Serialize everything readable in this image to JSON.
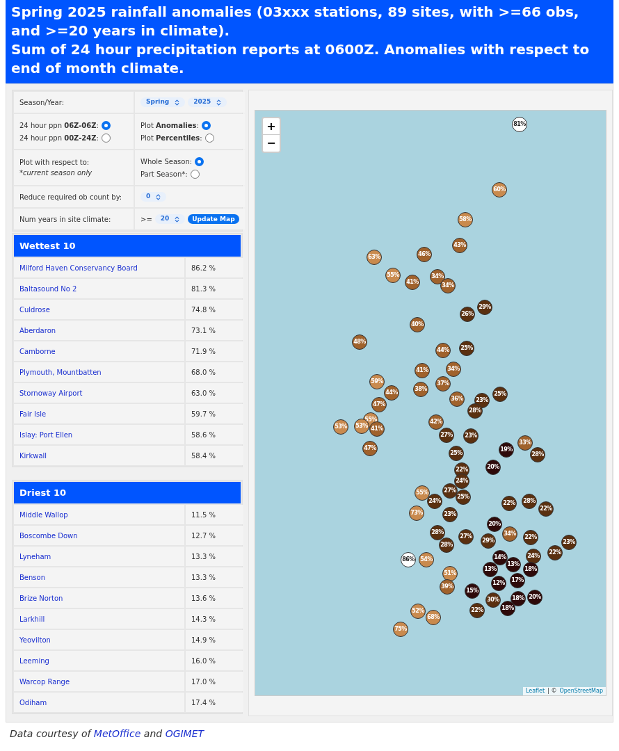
{
  "header": {
    "lines": [
      "Spring 2025 rainfall anomalies (03xxx stations, 89 sites, with >=66 obs, and >=20 years in climate).",
      "Sum of 24 hour precipitation reports at 0600Z. Anomalies with respect to end of month climate."
    ]
  },
  "controls": {
    "season_label": "Season/Year:",
    "season_select": "Spring",
    "year_select": "2025",
    "ppn_options": [
      {
        "label": "24 hour ppn **06Z-06Z**:",
        "selected": true
      },
      {
        "label": "24 hour ppn **00Z-24Z**:",
        "selected": false
      }
    ],
    "plot_options": [
      {
        "label": "Plot **Anomalies**:",
        "selected": true
      },
      {
        "label": "Plot **Percentiles**:",
        "selected": false
      }
    ],
    "respect_label": "Plot with respect to:",
    "respect_note": "*current season only",
    "respect_options": [
      {
        "label": "Whole Season:",
        "selected": true
      },
      {
        "label": "Part Season*:",
        "selected": false
      }
    ],
    "reduce_label": "Reduce required ob count by:",
    "reduce_select": "0",
    "years_label": "Num years in site climate:",
    "years_prefix": ">=",
    "years_select": "20",
    "update_button": "Update Map"
  },
  "tables": [
    {
      "title": "Wettest 10",
      "rows": [
        {
          "station": "Milford Haven Conservancy Board",
          "value": "86.2 %"
        },
        {
          "station": "Baltasound No 2",
          "value": "81.3 %"
        },
        {
          "station": "Culdrose",
          "value": "74.8 %"
        },
        {
          "station": "Aberdaron",
          "value": "73.1 %"
        },
        {
          "station": "Camborne",
          "value": "71.9 %"
        },
        {
          "station": "Plymouth, Mountbatten",
          "value": "68.0 %"
        },
        {
          "station": "Stornoway Airport",
          "value": "63.0 %"
        },
        {
          "station": "Fair Isle",
          "value": "59.7 %"
        },
        {
          "station": "Islay: Port Ellen",
          "value": "58.6 %"
        },
        {
          "station": "Kirkwall",
          "value": "58.4 %"
        }
      ]
    },
    {
      "title": "Driest 10",
      "rows": [
        {
          "station": "Middle Wallop",
          "value": "11.5 %"
        },
        {
          "station": "Boscombe Down",
          "value": "12.7 %"
        },
        {
          "station": "Lyneham",
          "value": "13.3 %"
        },
        {
          "station": "Benson",
          "value": "13.3 %"
        },
        {
          "station": "Brize Norton",
          "value": "13.6 %"
        },
        {
          "station": "Larkhill",
          "value": "14.3 %"
        },
        {
          "station": "Yeovilton",
          "value": "14.9 %"
        },
        {
          "station": "Leeming",
          "value": "16.0 %"
        },
        {
          "station": "Warcop Range",
          "value": "17.0 %"
        },
        {
          "station": "Odiham",
          "value": "17.4 %"
        }
      ]
    }
  ],
  "map": {
    "zoom_in": "+",
    "zoom_out": "−",
    "markers": [
      {
        "label": "81%",
        "color": "#ffffff"
      },
      {
        "label": "60%",
        "color": "#c98a4e"
      },
      {
        "label": "58%",
        "color": "#c98a4e"
      },
      {
        "label": "43%",
        "color": "#a0622c"
      },
      {
        "label": "63%",
        "color": "#c98a4e"
      },
      {
        "label": "46%",
        "color": "#a0622c"
      },
      {
        "label": "55%",
        "color": "#c98a4e"
      },
      {
        "label": "41%",
        "color": "#a0622c"
      },
      {
        "label": "34%",
        "color": "#a0622c"
      },
      {
        "label": "34%",
        "color": "#a0622c"
      },
      {
        "label": "29%",
        "color": "#5a3010"
      },
      {
        "label": "26%",
        "color": "#5a3010"
      },
      {
        "label": "40%",
        "color": "#a0622c"
      },
      {
        "label": "48%",
        "color": "#a0622c"
      },
      {
        "label": "44%",
        "color": "#a0622c"
      },
      {
        "label": "25%",
        "color": "#5a3010"
      },
      {
        "label": "41%",
        "color": "#a0622c"
      },
      {
        "label": "34%",
        "color": "#a0622c"
      },
      {
        "label": "59%",
        "color": "#c98a4e"
      },
      {
        "label": "37%",
        "color": "#a0622c"
      },
      {
        "label": "38%",
        "color": "#a0622c"
      },
      {
        "label": "44%",
        "color": "#a0622c"
      },
      {
        "label": "36%",
        "color": "#a0622c"
      },
      {
        "label": "25%",
        "color": "#5a3010"
      },
      {
        "label": "23%",
        "color": "#5a3010"
      },
      {
        "label": "47%",
        "color": "#a0622c"
      },
      {
        "label": "28%",
        "color": "#5a3010"
      },
      {
        "label": "55%",
        "color": "#c98a4e"
      },
      {
        "label": "53%",
        "color": "#c98a4e"
      },
      {
        "label": "53%",
        "color": "#c98a4e"
      },
      {
        "label": "41%",
        "color": "#a0622c"
      },
      {
        "label": "42%",
        "color": "#a0622c"
      },
      {
        "label": "27%",
        "color": "#5a3010"
      },
      {
        "label": "23%",
        "color": "#5a3010"
      },
      {
        "label": "47%",
        "color": "#a0622c"
      },
      {
        "label": "33%",
        "color": "#a0622c"
      },
      {
        "label": "19%",
        "color": "#2e0a0a"
      },
      {
        "label": "28%",
        "color": "#5a3010"
      },
      {
        "label": "25%",
        "color": "#5a3010"
      },
      {
        "label": "20%",
        "color": "#2e0a0a"
      },
      {
        "label": "22%",
        "color": "#5a3010"
      },
      {
        "label": "24%",
        "color": "#5a3010"
      },
      {
        "label": "55%",
        "color": "#c98a4e"
      },
      {
        "label": "27%",
        "color": "#5a3010"
      },
      {
        "label": "24%",
        "color": "#5a3010"
      },
      {
        "label": "25%",
        "color": "#5a3010"
      },
      {
        "label": "23%",
        "color": "#5a3010"
      },
      {
        "label": "73%",
        "color": "#c98a4e"
      },
      {
        "label": "22%",
        "color": "#5a3010"
      },
      {
        "label": "28%",
        "color": "#5a3010"
      },
      {
        "label": "22%",
        "color": "#5a3010"
      },
      {
        "label": "20%",
        "color": "#2e0a0a"
      },
      {
        "label": "34%",
        "color": "#a0622c"
      },
      {
        "label": "28%",
        "color": "#5a3010"
      },
      {
        "label": "27%",
        "color": "#5a3010"
      },
      {
        "label": "29%",
        "color": "#5a3010"
      },
      {
        "label": "22%",
        "color": "#5a3010"
      },
      {
        "label": "23%",
        "color": "#5a3010"
      },
      {
        "label": "28%",
        "color": "#5a3010"
      },
      {
        "label": "22%",
        "color": "#5a3010"
      },
      {
        "label": "86%",
        "color": "#ffffff"
      },
      {
        "label": "54%",
        "color": "#c98a4e"
      },
      {
        "label": "24%",
        "color": "#5a3010"
      },
      {
        "label": "14%",
        "color": "#2e0a0a"
      },
      {
        "label": "13%",
        "color": "#2e0a0a"
      },
      {
        "label": "13%",
        "color": "#2e0a0a"
      },
      {
        "label": "18%",
        "color": "#2e0a0a"
      },
      {
        "label": "51%",
        "color": "#c98a4e"
      },
      {
        "label": "12%",
        "color": "#2e0a0a"
      },
      {
        "label": "17%",
        "color": "#2e0a0a"
      },
      {
        "label": "39%",
        "color": "#a0622c"
      },
      {
        "label": "15%",
        "color": "#2e0a0a"
      },
      {
        "label": "30%",
        "color": "#5a3010"
      },
      {
        "label": "18%",
        "color": "#2e0a0a"
      },
      {
        "label": "20%",
        "color": "#2e0a0a"
      },
      {
        "label": "22%",
        "color": "#5a3010"
      },
      {
        "label": "18%",
        "color": "#2e0a0a"
      },
      {
        "label": "52%",
        "color": "#c98a4e"
      },
      {
        "label": "68%",
        "color": "#c98a4e"
      },
      {
        "label": "75%",
        "color": "#c98a4e"
      }
    ],
    "attribution": {
      "first_link": "Leaflet",
      "separator": "| ©",
      "second_link": "OpenStreetMap"
    }
  },
  "footer": {
    "text": "Data courtesy of",
    "first_link": "MetOffice",
    "joiner": "and",
    "second_link": "OGIMET"
  }
}
